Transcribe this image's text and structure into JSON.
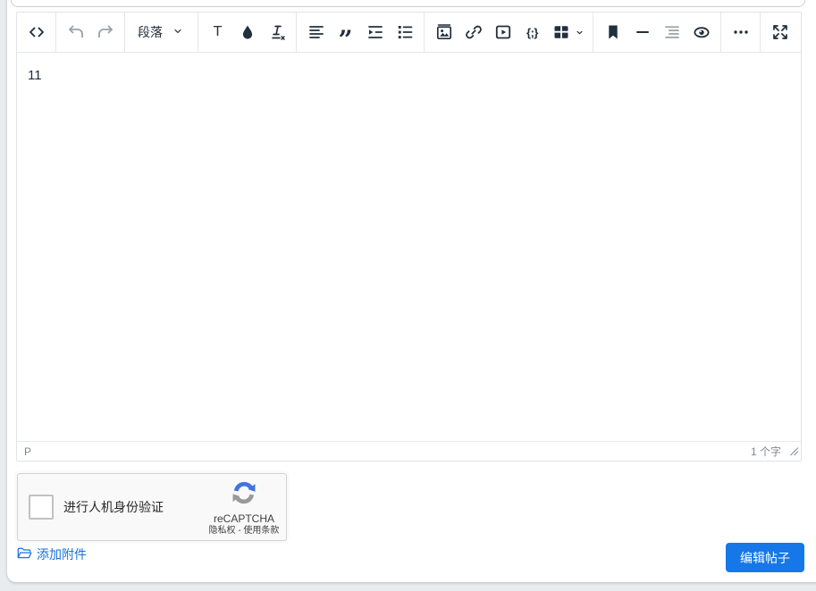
{
  "colors": {
    "page_background": "#e9ecef",
    "panel_background": "#ffffff",
    "toolbar_icon": "#222f3e",
    "toolbar_icon_disabled": "#98a2ab",
    "border": "#e1e5e9",
    "accent_blue": "#1677e8",
    "link_blue": "#1673e0",
    "recaptcha_background": "#f9f9f9",
    "recaptcha_border": "#d3d3d3",
    "recaptcha_logo_blue": "#4273df",
    "recaptcha_logo_gray": "#999999"
  },
  "editor": {
    "toolbar": {
      "paragraph_dropdown_label": "段落",
      "icon_glyphs": {
        "format_text": "T",
        "blockquote": "”",
        "code_sample": "{;}"
      },
      "button_names": [
        "source-code",
        "undo",
        "redo",
        "paragraph-format",
        "format-text",
        "text-color",
        "clear-formatting",
        "align-left",
        "blockquote",
        "indent",
        "unordered-list",
        "insert-image",
        "insert-link",
        "insert-media",
        "code-sample",
        "insert-table",
        "anchor",
        "horizontal-rule",
        "table-of-contents",
        "preview",
        "more-options",
        "fullscreen"
      ],
      "disabled_buttons": [
        "undo",
        "redo",
        "table-of-contents"
      ]
    },
    "content_text": "11",
    "statusbar": {
      "element_path": "P",
      "word_count": "1 个字"
    }
  },
  "recaptcha": {
    "checkbox_label": "进行人机身份验证",
    "brand_name": "reCAPTCHA",
    "privacy_terms": "隐私权 - 使用条款"
  },
  "attachments": {
    "add_attachment_label": "添加附件"
  },
  "actions": {
    "submit_button_label": "编辑帖子"
  }
}
